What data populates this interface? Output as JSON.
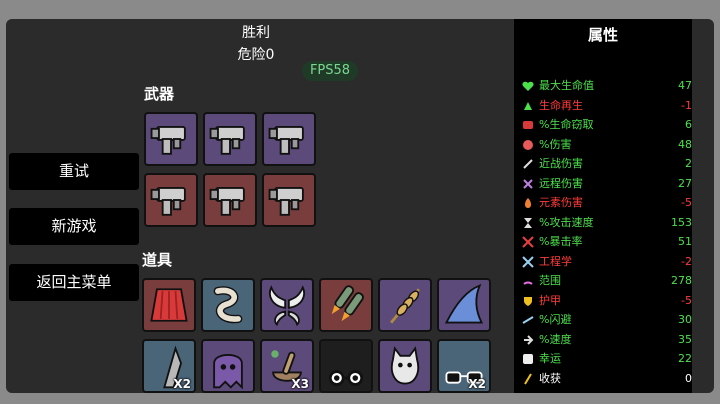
{
  "header": {
    "result": "胜利",
    "danger": "危险0",
    "fps": "FPS58"
  },
  "menu": {
    "retry": "重试",
    "new_game": "新游戏",
    "main_menu": "返回主菜单"
  },
  "sections": {
    "weapons": "武器",
    "items": "道具"
  },
  "weapons": [
    {
      "icon": "blaster-gun-icon",
      "tier": "purple"
    },
    {
      "icon": "blaster-gun-icon",
      "tier": "purple"
    },
    {
      "icon": "blaster-gun-icon",
      "tier": "purple"
    },
    {
      "icon": "blaster-gun-icon",
      "tier": "red"
    },
    {
      "icon": "blaster-gun-icon",
      "tier": "red"
    },
    {
      "icon": "blaster-gun-icon",
      "tier": "red"
    }
  ],
  "items": [
    {
      "icon": "red-cape-icon",
      "tier": "red",
      "count": ""
    },
    {
      "icon": "larva-worm-icon",
      "tier": "blue",
      "count": ""
    },
    {
      "icon": "angel-wings-icon",
      "tier": "purple",
      "count": ""
    },
    {
      "icon": "rockets-icon",
      "tier": "red",
      "count": ""
    },
    {
      "icon": "wheat-icon",
      "tier": "purple",
      "count": ""
    },
    {
      "icon": "shark-fin-icon",
      "tier": "purple",
      "count": ""
    },
    {
      "icon": "stone-tooth-icon",
      "tier": "blue",
      "count": "X2"
    },
    {
      "icon": "ghost-icon",
      "tier": "purple",
      "count": ""
    },
    {
      "icon": "mortar-pestle-icon",
      "tier": "purple",
      "count": "X3"
    },
    {
      "icon": "glasses-icon",
      "tier": "black",
      "count": ""
    },
    {
      "icon": "cat-icon",
      "tier": "purple",
      "count": ""
    },
    {
      "icon": "sunglasses-icon",
      "tier": "blue",
      "count": "X2"
    }
  ],
  "stats": {
    "title": "属性",
    "rows": [
      {
        "icon": "heart-icon",
        "label": "最大生命值",
        "value": "47",
        "color": "#4ce04c"
      },
      {
        "icon": "regen-icon",
        "label": "生命再生",
        "value": "-1",
        "color": "#ff3b3b"
      },
      {
        "icon": "lifesteal-icon",
        "label": "%生命窃取",
        "value": "6",
        "color": "#4ce04c"
      },
      {
        "icon": "damage-icon",
        "label": "%伤害",
        "value": "48",
        "color": "#4ce04c"
      },
      {
        "icon": "melee-sword-icon",
        "label": "近战伤害",
        "value": "2",
        "color": "#4ce04c"
      },
      {
        "icon": "ranged-icon",
        "label": "远程伤害",
        "value": "27",
        "color": "#4ce04c"
      },
      {
        "icon": "elemental-flame-icon",
        "label": "元素伤害",
        "value": "-5",
        "color": "#ff3b3b"
      },
      {
        "icon": "hourglass-icon",
        "label": "%攻击速度",
        "value": "153",
        "color": "#4ce04c"
      },
      {
        "icon": "crit-icon",
        "label": "%暴击率",
        "value": "51",
        "color": "#4ce04c"
      },
      {
        "icon": "engineering-icon",
        "label": "工程学",
        "value": "-2",
        "color": "#ff3b3b"
      },
      {
        "icon": "range-icon",
        "label": "范围",
        "value": "278",
        "color": "#4ce04c"
      },
      {
        "icon": "armor-shield-icon",
        "label": "护甲",
        "value": "-5",
        "color": "#ff3b3b"
      },
      {
        "icon": "dodge-icon",
        "label": "%闪避",
        "value": "30",
        "color": "#4ce04c"
      },
      {
        "icon": "speed-icon",
        "label": "%速度",
        "value": "35",
        "color": "#4ce04c"
      },
      {
        "icon": "luck-dice-icon",
        "label": "幸运",
        "value": "22",
        "color": "#4ce04c"
      },
      {
        "icon": "harvest-icon",
        "label": "收获",
        "value": "0",
        "color": "#ffffff"
      }
    ]
  }
}
